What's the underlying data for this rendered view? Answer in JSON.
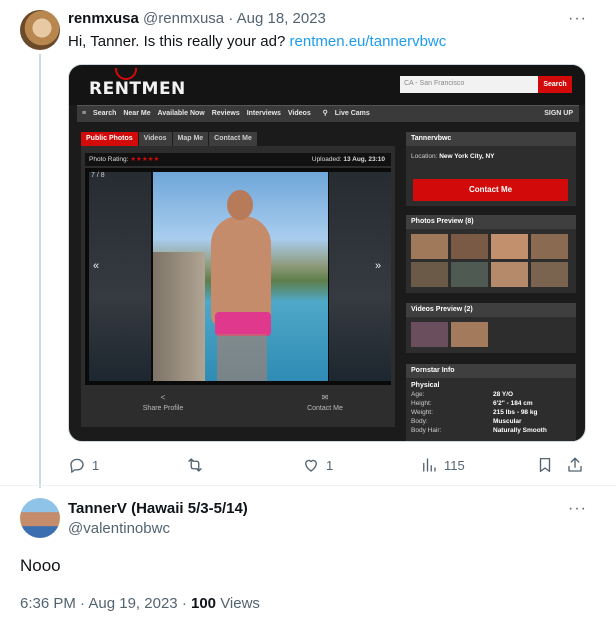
{
  "tweet1": {
    "name": "renmxusa",
    "handle": "@renmxusa",
    "separator": "·",
    "date": "Aug 18, 2023",
    "text": "Hi, Tanner. Is this really your ad?",
    "link": "rentmen.eu/tannervbwc",
    "more": "···",
    "actions": {
      "replies": "1",
      "retweets": "",
      "likes": "1",
      "views": "115"
    },
    "embedded_page": {
      "logo": "RENTMEN",
      "search_placeholder": "CA - San Francisco",
      "search_button": "Search",
      "nav": [
        "Search",
        "Near Me",
        "Available Now",
        "Reviews",
        "Interviews",
        "Videos",
        "Live Cams"
      ],
      "signup": "SIGN UP",
      "tabs": [
        "Public Photos",
        "Videos",
        "Map Me",
        "Contact Me"
      ],
      "photo_rating_label": "Photo Rating:",
      "stars": "★★★★★",
      "uploaded_label": "Uploaded:",
      "uploaded_value": "13 Aug, 23:10",
      "photo_counter": "7 / 8",
      "prev": "«",
      "next": "»",
      "share_profile": "Share Profile",
      "contact_me_link": "Contact Me",
      "profile_name": "Tannervbwc",
      "location_label": "Location:",
      "location_value": "New York City, NY",
      "contact_button": "Contact Me",
      "photos_preview": "Photos Preview (8)",
      "videos_preview": "Videos Preview (2)",
      "pornstar_info": "Pornstar Info",
      "physical": "Physical",
      "info": [
        {
          "label": "Age:",
          "value": "28 Y/O"
        },
        {
          "label": "Height:",
          "value": "6'2\" - 184 cm"
        },
        {
          "label": "Weight:",
          "value": "215 lbs - 98 kg"
        },
        {
          "label": "Body:",
          "value": "Muscular"
        },
        {
          "label": "Body Hair:",
          "value": "Naturally Smooth"
        }
      ],
      "colors": {
        "brand_red": "#d20a0a",
        "background": "#1b1b1b"
      }
    }
  },
  "tweet2": {
    "name": "TannerV (Hawaii 5/3-5/14)",
    "handle": "@valentinobwc",
    "more": "···",
    "text": "Nooo",
    "time": "6:36 PM",
    "separator": "·",
    "date": "Aug 19, 2023",
    "separator2": "·",
    "views_count": "100",
    "views_label": "Views"
  },
  "colors": {
    "link": "#1d9bf0",
    "muted": "#536471",
    "text": "#0f1419"
  }
}
